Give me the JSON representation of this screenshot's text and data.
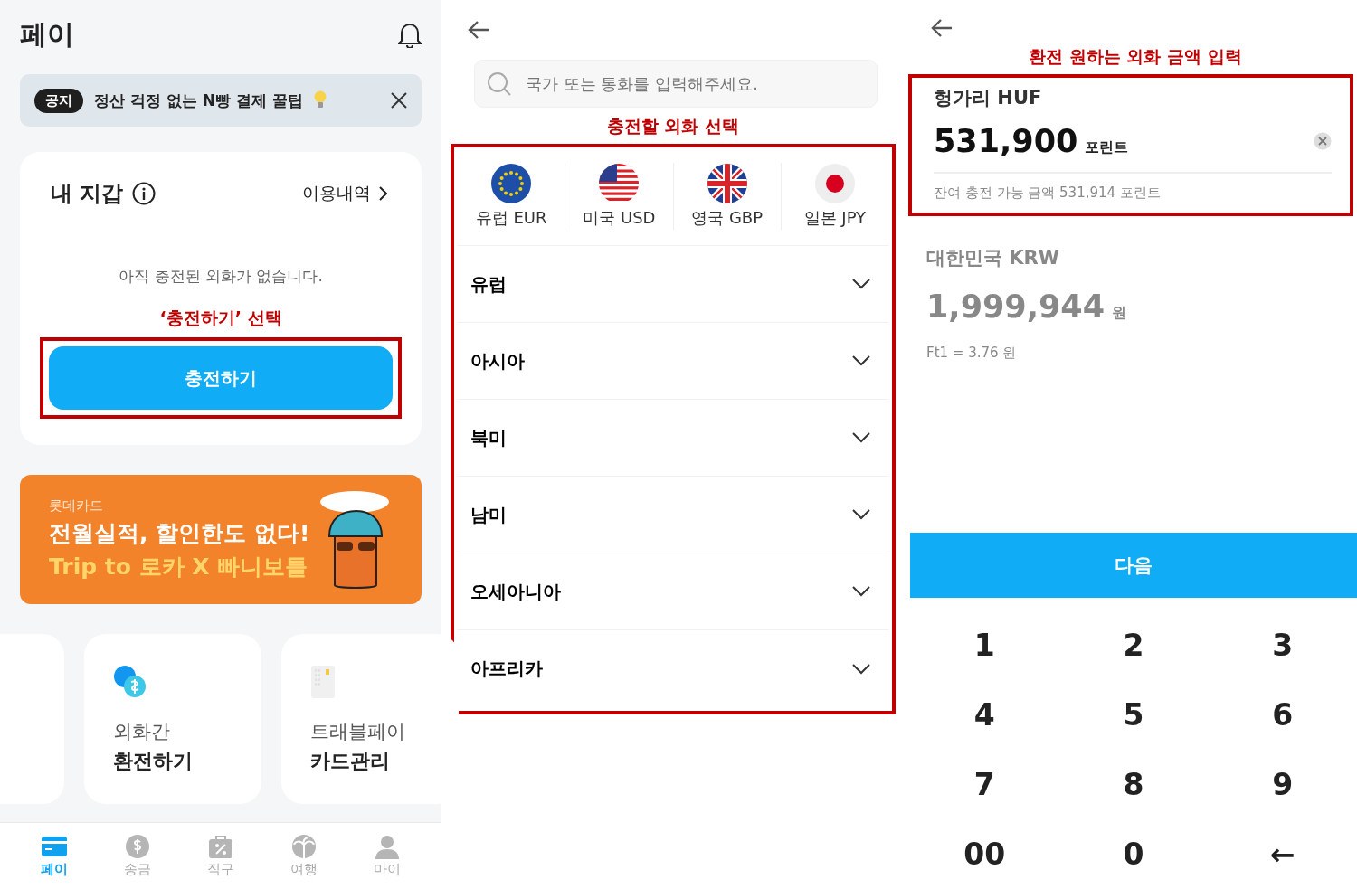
{
  "pay_screen": {
    "title": "페이",
    "notice": {
      "badge": "공지",
      "text": "정산 걱정 없는 N빵 결제 꿀팁"
    },
    "wallet": {
      "title": "내 지갑",
      "history_link": "이용내역",
      "empty_message": "아직 충전된 외화가 없습니다.",
      "annotation": "‘충전하기’ 선택",
      "charge_button": "충전하기"
    },
    "banner": {
      "brand": "롯데카드",
      "headline": "전월실적, 할인한도 없다!",
      "subline": "Trip to 로카 X 빠니보틀",
      "kind": "picture"
    },
    "shortcuts": [
      {
        "kind": "exchange",
        "line1": "외화간",
        "line2": "환전하기"
      },
      {
        "kind": "card",
        "line1": "트래블페이",
        "line2": "카드관리"
      }
    ],
    "nav": [
      {
        "kind": "card",
        "label": "페이",
        "selected": true
      },
      {
        "kind": "coin",
        "label": "송금",
        "selected": false
      },
      {
        "kind": "bag",
        "label": "직구",
        "selected": false
      },
      {
        "kind": "palm",
        "label": "여행",
        "selected": false
      },
      {
        "kind": "person",
        "label": "마이",
        "selected": false
      }
    ]
  },
  "currency_screen": {
    "search": {
      "placeholder": "국가 또는 통화를 입력해주세요."
    },
    "annotation": "충전할 외화 선택",
    "popular": [
      {
        "kind": "eu",
        "label": "유럽 EUR"
      },
      {
        "kind": "us",
        "label": "미국 USD"
      },
      {
        "kind": "gb",
        "label": "영국 GBP"
      },
      {
        "kind": "jp",
        "label": "일본 JPY"
      }
    ],
    "regions": [
      {
        "label": "유럽",
        "expanded": false
      },
      {
        "label": "아시아",
        "expanded": false
      },
      {
        "label": "북미",
        "expanded": false
      },
      {
        "label": "남미",
        "expanded": false
      },
      {
        "label": "오세아니아",
        "expanded": false
      },
      {
        "label": "아프리카",
        "expanded": false
      }
    ]
  },
  "amount_screen": {
    "annotation": "환전 원하는 외화 금액 입력",
    "from": {
      "currency": "헝가리 HUF",
      "amount": "531,900",
      "unit": "포린트",
      "remaining": "잔여 충전 가능 금액 531,914 포린트"
    },
    "to": {
      "currency": "대한민국 KRW",
      "amount": "1,999,944",
      "unit": "원",
      "rate": "Ft1 = 3.76 원"
    },
    "next_button": "다음",
    "keypad": [
      "1",
      "2",
      "3",
      "4",
      "5",
      "6",
      "7",
      "8",
      "9",
      "00",
      "0",
      "←"
    ]
  }
}
